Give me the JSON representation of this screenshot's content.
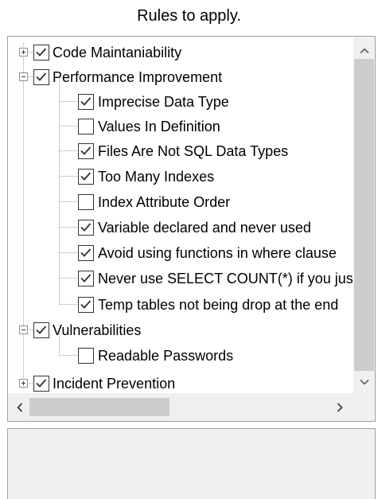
{
  "header": {
    "title": "Rules to apply."
  },
  "tree": {
    "items": [
      {
        "label": "Code Maintaniability",
        "checked": true,
        "expander": "plus"
      },
      {
        "label": "Performance Improvement",
        "checked": true,
        "expander": "minus"
      },
      {
        "label": "Imprecise Data Type",
        "checked": true
      },
      {
        "label": "Values In Definition",
        "checked": false
      },
      {
        "label": "Files Are Not SQL Data Types",
        "checked": true
      },
      {
        "label": "Too Many Indexes",
        "checked": true
      },
      {
        "label": "Index Attribute Order",
        "checked": false
      },
      {
        "label": "Variable declared and never used",
        "checked": true
      },
      {
        "label": "Avoid using functions in where clause",
        "checked": true
      },
      {
        "label": "Never use SELECT COUNT(*) if you just need to check existence",
        "checked": true
      },
      {
        "label": "Temp tables not being drop at the end",
        "checked": true
      },
      {
        "label": "Vulnerabilities",
        "checked": true,
        "expander": "minus"
      },
      {
        "label": "Readable Passwords",
        "checked": false
      },
      {
        "label": "Incident Prevention",
        "checked": true,
        "expander": "plus"
      }
    ]
  },
  "icons": {
    "expand": "plus-box-icon",
    "collapse": "minus-box-icon",
    "check": "checkmark-icon",
    "scroll_up": "chevron-up-icon",
    "scroll_down": "chevron-down-icon",
    "scroll_left": "chevron-left-icon",
    "scroll_right": "chevron-right-icon"
  },
  "colors": {
    "border": "#a0a0a0",
    "scroll_track": "#f0f0f0",
    "scroll_thumb": "#cdcdcd",
    "tree_lines": "#a0a0a0"
  }
}
